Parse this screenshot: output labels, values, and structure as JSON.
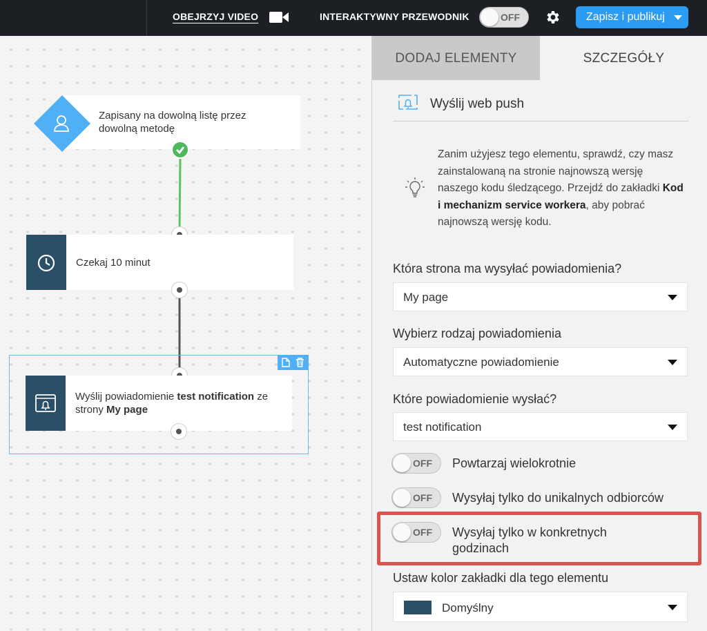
{
  "topbar": {
    "video_link": "OBEJRZYJ VIDEO",
    "guide_label": "INTERAKTYWNY PRZEWODNIK",
    "guide_toggle": "OFF",
    "publish_button": "Zapisz i publikuj",
    "icons": [
      "video-camera-icon",
      "gear-icon",
      "chevron-down-icon"
    ]
  },
  "canvas": {
    "nodes": [
      {
        "type": "trigger",
        "text": "Zapisany na dowolną listę przez dowolną metodę",
        "icon": "user-icon"
      },
      {
        "type": "wait",
        "text": "Czekaj 10 minut",
        "icon": "clock-icon"
      },
      {
        "type": "web-push",
        "text_parts": [
          "Wyślij powiadomienie ",
          "test notification",
          " ze strony ",
          "My page"
        ],
        "icon": "bell-window-icon"
      }
    ],
    "colors": {
      "node_side": "#2b4f66",
      "trigger": "#4fb0f6",
      "success": "#4cb85c",
      "selection": "#6bb7e6"
    }
  },
  "panel": {
    "tabs": [
      {
        "label": "DODAJ ELEMENTY",
        "active": false
      },
      {
        "label": "SZCZEGÓŁY",
        "active": true
      }
    ],
    "section_title": "Wyślij web push",
    "info": {
      "p1": "Zanim użyjesz tego elementu, sprawdź, czy masz zainstalowaną na stronie najnowszą wersję naszego kodu śledzącego. Przejdź do zakładki ",
      "bold": "Kod i mechanizm service workera",
      "p2": ", aby pobrać najnowszą wersję kodu."
    },
    "fields": {
      "page_label": "Która strona ma wysyłać powiadomienia?",
      "page_value": "My page",
      "type_label": "Wybierz rodzaj powiadomienia",
      "type_value": "Automatyczne powiadomienie",
      "notif_label": "Które powiadomienie wysłać?",
      "notif_value": "test notification",
      "color_label": "Ustaw kolor zakładki dla tego elementu",
      "color_value": "Domyślny",
      "color_swatch": "#2b4f66"
    },
    "toggles": [
      {
        "state": "OFF",
        "label": "Powtarzaj wielokrotnie"
      },
      {
        "state": "OFF",
        "label": "Wysyłaj tylko do unikalnych odbiorców"
      },
      {
        "state": "OFF",
        "label": "Wysyłaj tylko w konkretnych godzinach"
      }
    ],
    "highlight_color": "#d9534f"
  }
}
